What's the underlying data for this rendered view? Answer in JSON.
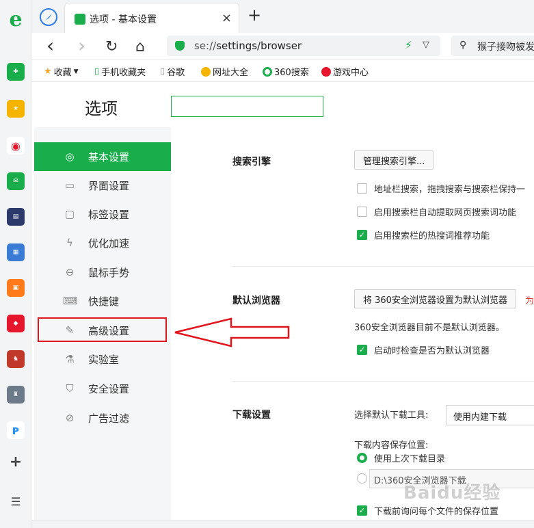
{
  "window": {
    "tab_title": "选项 - 基本设置",
    "close_glyph": "×",
    "new_tab_glyph": "+"
  },
  "navigation": {
    "back_glyph": "‹",
    "forward_glyph": "›",
    "reload_glyph": "↻",
    "home_glyph": "⌂"
  },
  "address": {
    "url_prefix": "se://",
    "url_path": "settings/browser"
  },
  "search": {
    "placeholder": "猴子接吻被发"
  },
  "bookmarks": [
    {
      "label": "收藏",
      "icon": "star-icon"
    },
    {
      "label": "手机收藏夹",
      "icon": "phone-icon"
    },
    {
      "label": "谷歌",
      "icon": "page-icon"
    },
    {
      "label": "网址大全",
      "icon": "globe-icon"
    },
    {
      "label": "360搜索",
      "icon": "search-360-icon"
    },
    {
      "label": "游戏中心",
      "icon": "game-icon"
    }
  ],
  "settings_header": {
    "title": "选项",
    "search_value": ""
  },
  "sidebar": [
    {
      "label": "基本设置",
      "icon": "gear-icon",
      "active": true
    },
    {
      "label": "界面设置",
      "icon": "window-icon"
    },
    {
      "label": "标签设置",
      "icon": "tab-icon"
    },
    {
      "label": "优化加速",
      "icon": "lightning-icon"
    },
    {
      "label": "鼠标手势",
      "icon": "mouse-icon"
    },
    {
      "label": "快捷键",
      "icon": "keyboard-icon"
    },
    {
      "label": "高级设置",
      "icon": "wrench-icon"
    },
    {
      "label": "实验室",
      "icon": "flask-icon"
    },
    {
      "label": "安全设置",
      "icon": "shield-icon"
    },
    {
      "label": "广告过滤",
      "icon": "block-icon"
    }
  ],
  "search_engine": {
    "title": "搜索引擎",
    "manage_button": "管理搜索引擎...",
    "options": [
      {
        "label": "地址栏搜索，拖拽搜索与搜索栏保持一",
        "checked": false
      },
      {
        "label": "启用搜索栏自动提取网页搜索词功能",
        "checked": false
      },
      {
        "label": "启用搜索栏的热搜词推荐功能",
        "checked": true
      }
    ]
  },
  "default_browser": {
    "title": "默认浏览器",
    "set_button": "将 360安全浏览器设置为默认浏览器",
    "hint": "为",
    "status": "360安全浏览器目前不是默认浏览器。",
    "check_option": {
      "label": "启动时检查是否为默认浏览器",
      "checked": true
    }
  },
  "download": {
    "title": "下载设置",
    "tool_label": "选择默认下载工具:",
    "tool_value": "使用内建下载",
    "location_label": "下载内容保存位置:",
    "radio_last": {
      "label": "使用上次下载目录",
      "checked": true
    },
    "radio_custom": {
      "checked": false
    },
    "custom_path": "D:\\360安全浏览器下载",
    "ask_option": {
      "label": "下载前询问每个文件的保存位置",
      "checked": true
    }
  },
  "watermark": "Baidu经验",
  "colors": {
    "accent": "#1aad4c",
    "annotation": "#e0161e"
  }
}
